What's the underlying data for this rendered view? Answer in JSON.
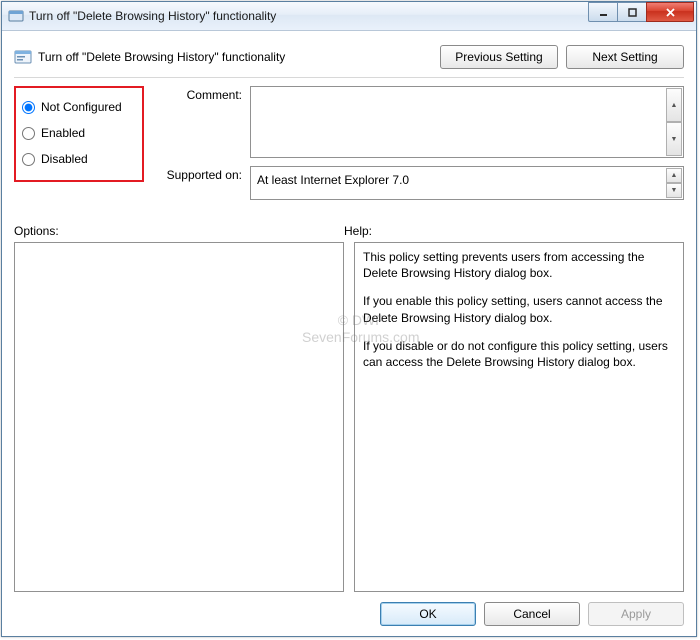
{
  "window": {
    "title": "Turn off \"Delete Browsing History\" functionality"
  },
  "header": {
    "title": "Turn off \"Delete Browsing History\" functionality",
    "prev": "Previous Setting",
    "next": "Next Setting"
  },
  "state": {
    "options": {
      "not_configured": "Not Configured",
      "enabled": "Enabled",
      "disabled": "Disabled"
    },
    "selected": "not_configured"
  },
  "fields": {
    "comment_label": "Comment:",
    "comment_value": "",
    "supported_label": "Supported on:",
    "supported_value": "At least Internet Explorer 7.0"
  },
  "labels": {
    "options": "Options:",
    "help": "Help:"
  },
  "help": {
    "p1": "This policy setting prevents users from accessing the Delete Browsing History dialog box.",
    "p2": "If you enable this policy setting, users cannot access the Delete Browsing History dialog box.",
    "p3": "If you disable or do not configure this policy setting, users can access the Delete Browsing History dialog box."
  },
  "footer": {
    "ok": "OK",
    "cancel": "Cancel",
    "apply": "Apply"
  },
  "watermark": {
    "l1": "© DWF",
    "l2": "SevenForums.com"
  }
}
